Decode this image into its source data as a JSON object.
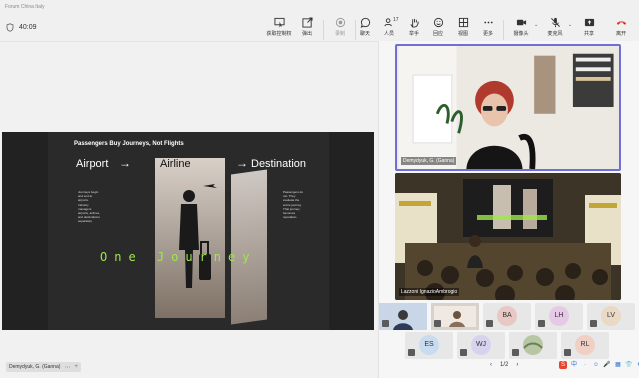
{
  "app": {
    "window_title": "Forum China Italy"
  },
  "toolbar": {
    "timer": "40:09",
    "items": [
      {
        "key": "request-control",
        "label": "获取控制权"
      },
      {
        "key": "popout",
        "label": "弹出"
      },
      {
        "key": "record",
        "label": "录制"
      },
      {
        "key": "chat",
        "label": "聊天"
      },
      {
        "key": "people",
        "label": "人员",
        "count": "17"
      },
      {
        "key": "raise-hand",
        "label": "举手"
      },
      {
        "key": "react",
        "label": "回应"
      },
      {
        "key": "view",
        "label": "视图"
      },
      {
        "key": "more",
        "label": "更多"
      },
      {
        "key": "camera",
        "label": "摄像头"
      },
      {
        "key": "mic",
        "label": "麦克风"
      },
      {
        "key": "share",
        "label": "共享"
      },
      {
        "key": "leave",
        "label": "离开"
      }
    ]
  },
  "slide": {
    "title": "Passengers Buy Journeys, Not Flights",
    "word_left": "Airport",
    "word_mid": "Airline",
    "word_right": "Destination",
    "arrow": "→",
    "bullets_left": "Journeys begin and end at airports. Industry managers airports, airlines, and destinations separately.",
    "bullets_right": "Passengers do not. They evaluate the entire journey. That journey becomes reputation.",
    "tagline": "One Journey"
  },
  "presenter_tag": {
    "name": "Demydyuk, G. (Ganna)",
    "plus": "+"
  },
  "participants": {
    "video1_name": "Demydyuk, G. (Ganna)",
    "video2_name": "Lazzoni IgnazioAmbrogio",
    "tiles": [
      {
        "initials": "",
        "color": "#c9d6e8"
      },
      {
        "initials": "",
        "color": "#d8d2cc"
      },
      {
        "initials": "BA",
        "color": "#e7c8c4"
      },
      {
        "initials": "LH",
        "color": "#e6c9e6"
      },
      {
        "initials": "LV",
        "color": "#ead9c4"
      },
      {
        "initials": "ES",
        "color": "#c9dcef"
      },
      {
        "initials": "WJ",
        "color": "#d7d2ee"
      },
      {
        "initials": "",
        "color": "#b7c7a4"
      },
      {
        "initials": "RL",
        "color": "#f0cfc4"
      }
    ],
    "pager": {
      "prev": "‹",
      "page": "1/2",
      "next": "›"
    }
  },
  "tray": {
    "items": [
      "S",
      "中",
      "·",
      "☺",
      "🎤",
      "▦",
      "👕",
      "⚙",
      "Ai"
    ]
  }
}
